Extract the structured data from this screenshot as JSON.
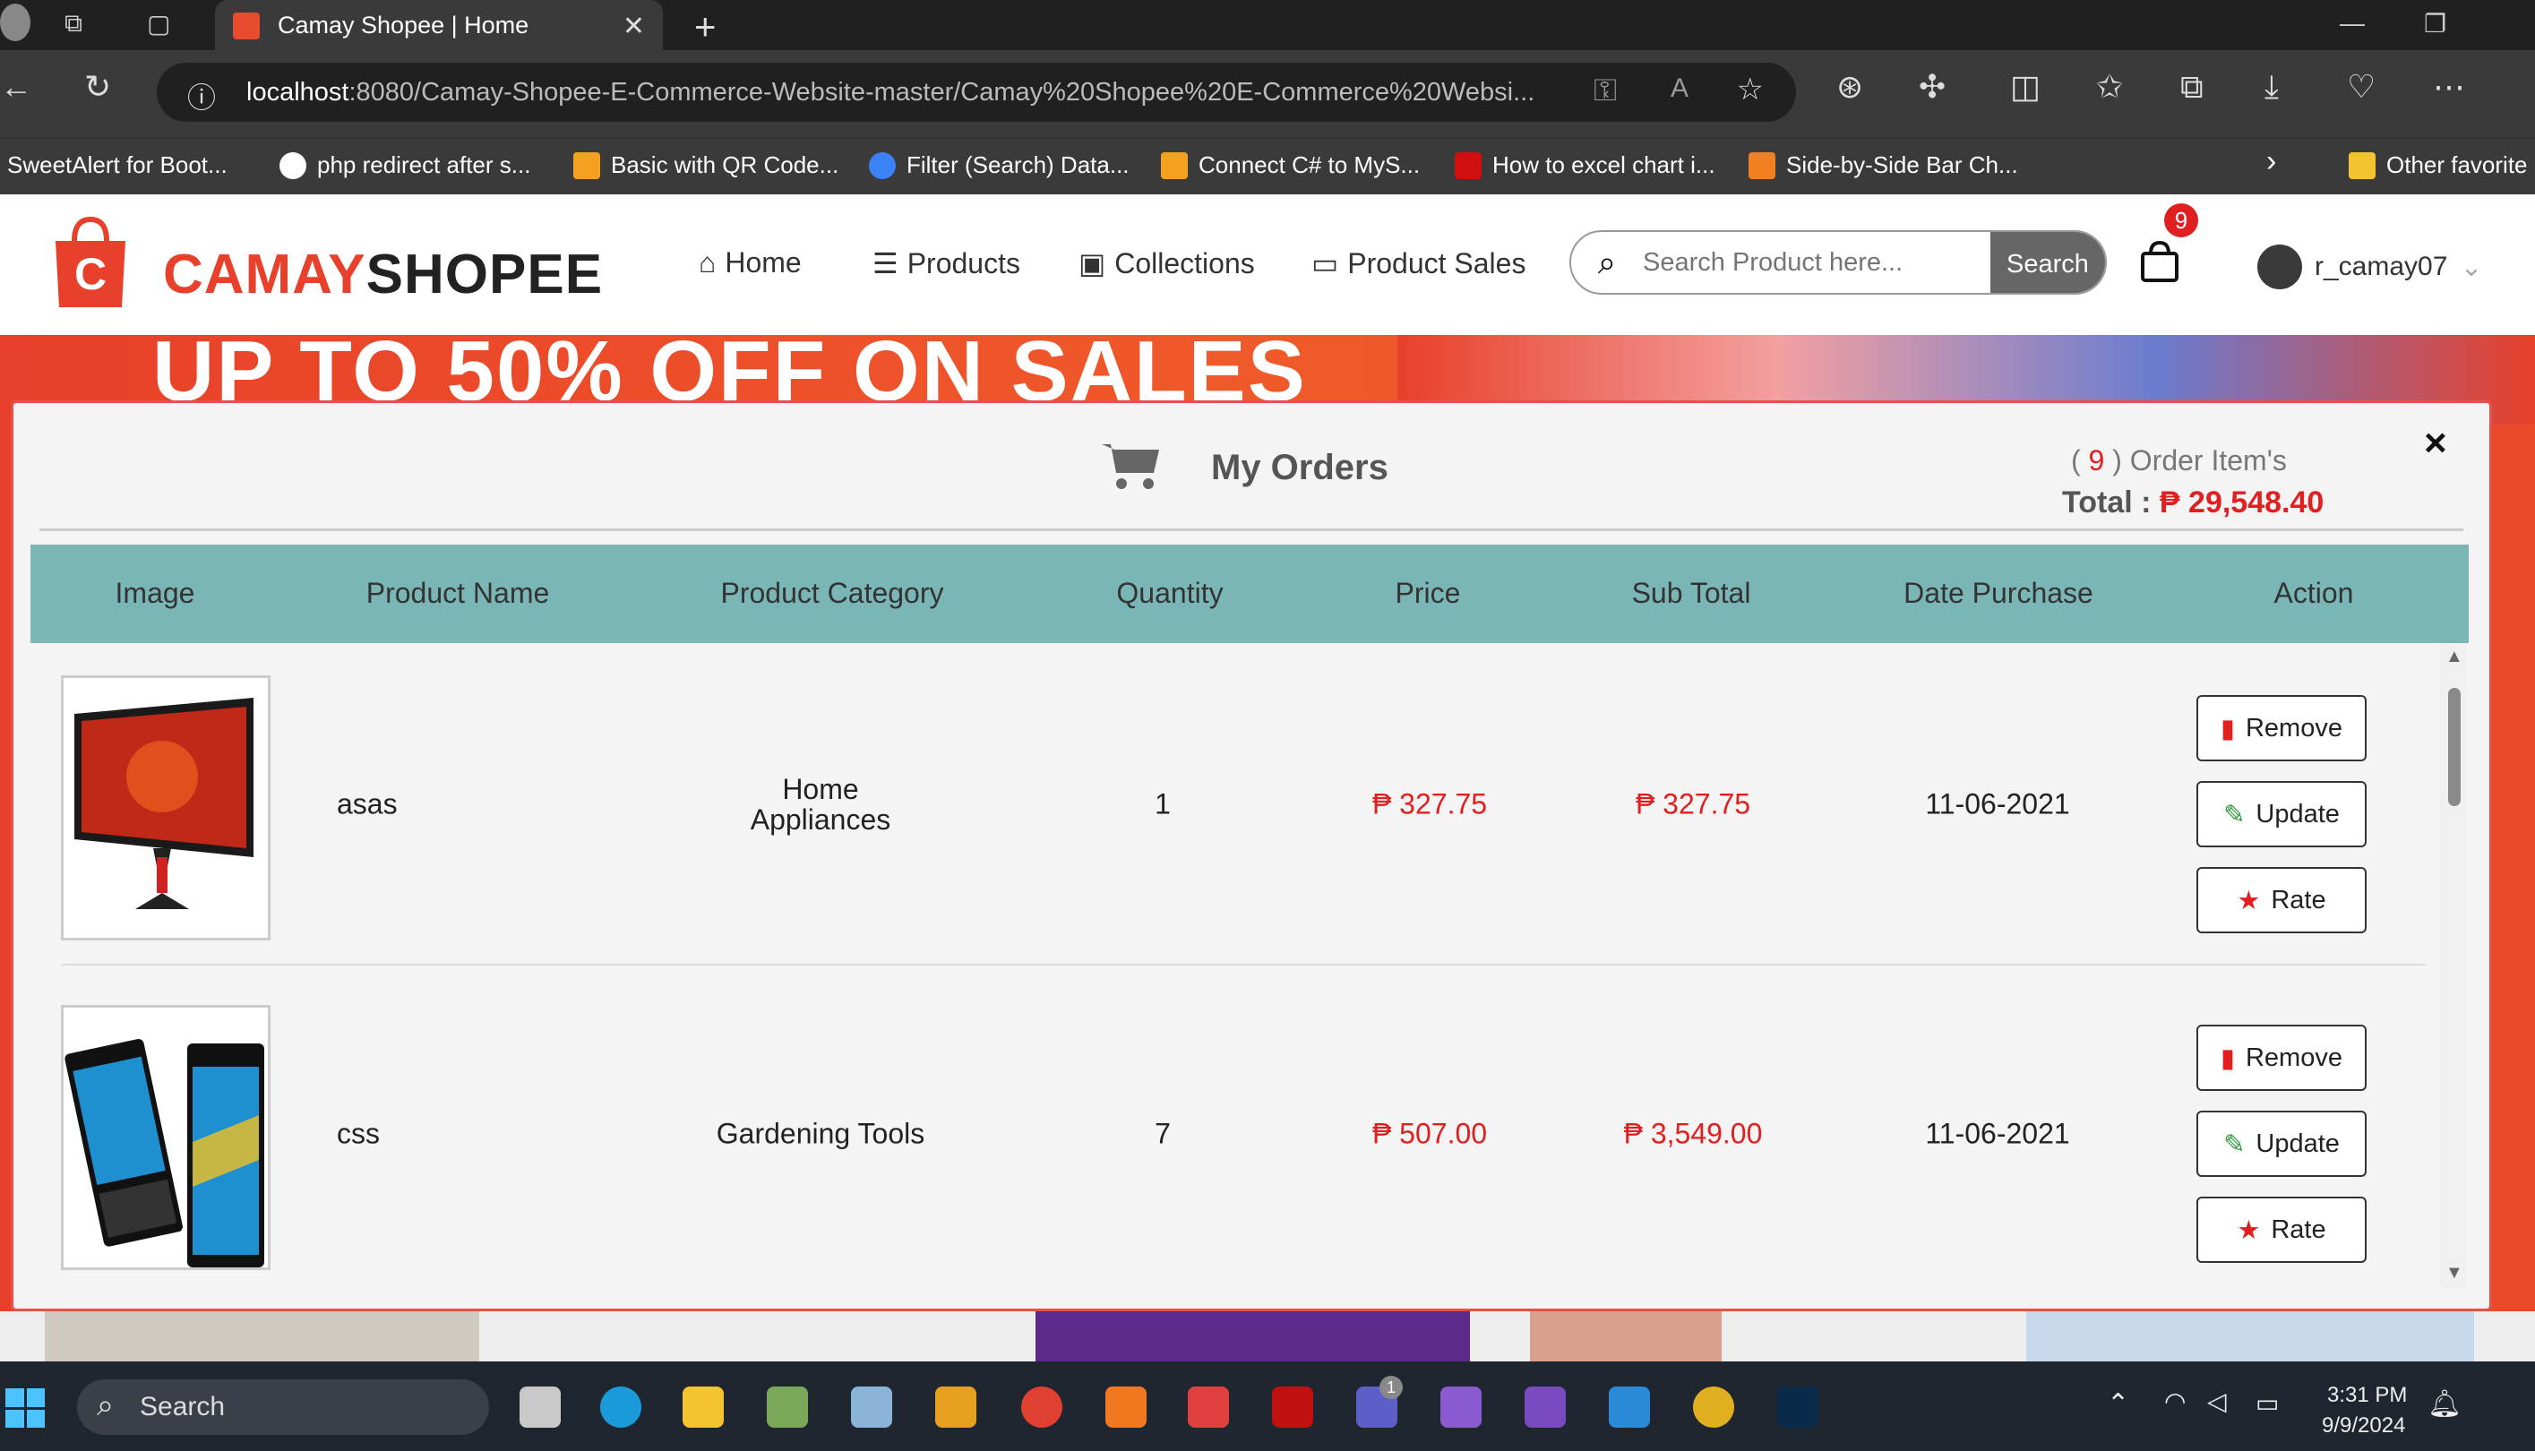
{
  "browser": {
    "tab_title": "Camay Shopee | Home",
    "url_host": "localhost",
    "url_rest": ":8080/Camay-Shopee-E-Commerce-Website-master/Camay%20Shopee%20E-Commerce%20Websi...",
    "bookmarks": [
      {
        "label": "SweetAlert for Boot...",
        "color": "#cfcfcf"
      },
      {
        "label": "php redirect after s...",
        "color": "#ffffff"
      },
      {
        "label": "Basic with QR Code...",
        "color": "#f4a020"
      },
      {
        "label": "Filter (Search) Data...",
        "color": "#3b82f6"
      },
      {
        "label": "Connect C# to MyS...",
        "color": "#f4a020"
      },
      {
        "label": "How to excel chart i...",
        "color": "#d01010"
      },
      {
        "label": "Side-by-Side Bar Ch...",
        "color": "#f08020"
      }
    ],
    "other_favorites": "Other favorite"
  },
  "site": {
    "brand_part1": "CAMAY",
    "brand_part2": "SHOPEE",
    "nav": [
      {
        "label": "Home",
        "icon": "home-icon"
      },
      {
        "label": "Products",
        "icon": "list-icon"
      },
      {
        "label": "Collections",
        "icon": "briefcase-icon"
      },
      {
        "label": "Product Sales",
        "icon": "monitor-icon"
      }
    ],
    "search_placeholder": "Search Product here...",
    "search_button": "Search",
    "cart_count": "9",
    "username": "r_camay07",
    "banner_text": "UP TO 50% OFF ON SALES",
    "brand_color": "#e8402a"
  },
  "modal": {
    "title": "My Orders",
    "order_count": "9",
    "order_count_label": ") Order Item's",
    "order_count_prefix": "(",
    "total_label": "Total :",
    "total_amount": "₱ 29,548.40",
    "close": "×",
    "columns": [
      "Image",
      "Product Name",
      "Product Category",
      "Quantity",
      "Price",
      "Sub Total",
      "Date Purchase",
      "Action"
    ],
    "header_color": "#7bb6b6",
    "rows": [
      {
        "name": "asas",
        "category_line1": "Home",
        "category_line2": "Appliances",
        "quantity": "1",
        "price": "₱ 327.75",
        "subtotal": "₱ 327.75",
        "date": "11-06-2021",
        "image": "monitor"
      },
      {
        "name": "css",
        "category_line1": "Gardening Tools",
        "category_line2": "",
        "quantity": "7",
        "price": "₱ 507.00",
        "subtotal": "₱ 3,549.00",
        "date": "11-06-2021",
        "image": "phones"
      }
    ],
    "actions": {
      "remove": "Remove",
      "update": "Update",
      "rate": "Rate"
    }
  },
  "taskbar": {
    "search": "Search",
    "time": "3:31 PM",
    "date": "9/9/2024",
    "teams_badge": "1"
  }
}
